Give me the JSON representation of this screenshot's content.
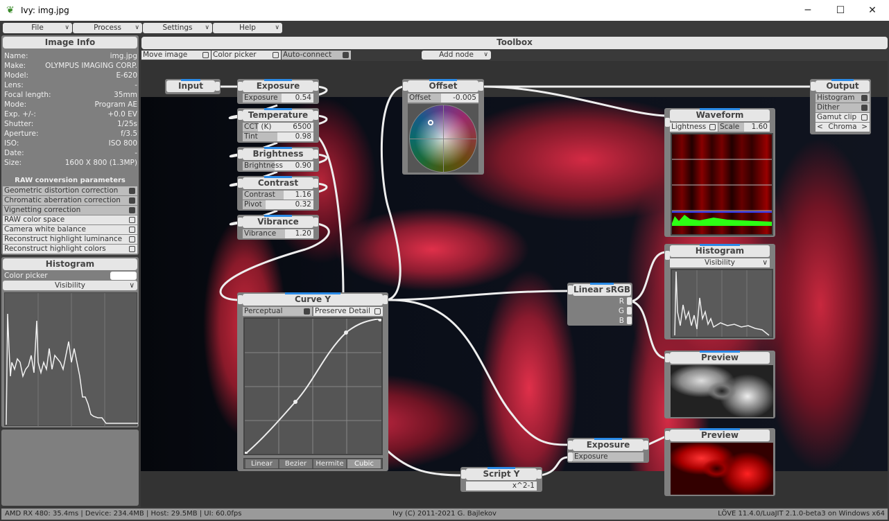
{
  "window": {
    "title": "Ivy: img.jpg",
    "minimize": "─",
    "maximize": "☐",
    "close": "✕"
  },
  "menu": [
    "File",
    "Process",
    "Settings",
    "Help"
  ],
  "image_info": {
    "title": "Image Info",
    "rows": [
      {
        "k": "Name:",
        "v": "img.jpg"
      },
      {
        "k": "Make:",
        "v": "OLYMPUS IMAGING CORP."
      },
      {
        "k": "Model:",
        "v": "E-620"
      },
      {
        "k": "Lens:",
        "v": "-"
      },
      {
        "k": "Focal length:",
        "v": "35mm"
      },
      {
        "k": "Mode:",
        "v": "Program AE"
      },
      {
        "k": "Exp. +/-:",
        "v": "+0.0 EV"
      },
      {
        "k": "Shutter:",
        "v": "1/25s"
      },
      {
        "k": "Aperture:",
        "v": "f/3.5"
      },
      {
        "k": "ISO:",
        "v": "ISO 800"
      },
      {
        "k": "Date:",
        "v": "-"
      },
      {
        "k": "Size:",
        "v": "1600 X 800 (1.3MP)"
      }
    ],
    "raw_title": "RAW conversion parameters",
    "raw": [
      {
        "label": "Geometric distortion correction",
        "on": true
      },
      {
        "label": "Chromatic aberration correction",
        "on": true
      },
      {
        "label": "Vignetting correction",
        "on": true
      },
      {
        "label": "RAW color space",
        "on": false
      },
      {
        "label": "Camera white balance",
        "on": false
      },
      {
        "label": "Reconstruct highlight luminance",
        "on": false
      },
      {
        "label": "Reconstruct highlight colors",
        "on": false
      }
    ]
  },
  "histogram_panel": {
    "title": "Histogram",
    "color_picker": "Color picker",
    "mode": "Visibility"
  },
  "toolbox": {
    "title": "Toolbox",
    "move_image": "Move image",
    "color_picker": "Color picker",
    "auto_connect": "Auto-connect",
    "add_node": "Add node"
  },
  "nodes": {
    "input": "Input",
    "exposure": {
      "title": "Exposure",
      "label": "Exposure",
      "value": "0.54"
    },
    "temperature": {
      "title": "Temperature",
      "cct_label": "CCT (K)",
      "cct": "6500",
      "tint_label": "Tint",
      "tint": "0.98"
    },
    "brightness": {
      "title": "Brightness",
      "label": "Brightness",
      "value": "0.90"
    },
    "contrast": {
      "title": "Contrast",
      "label": "Contrast",
      "value": "1.16",
      "pivot_label": "Pivot",
      "pivot": "0.32"
    },
    "vibrance": {
      "title": "Vibrance",
      "label": "Vibrance",
      "value": "1.20"
    },
    "offset": {
      "title": "Offset",
      "label": "Offset",
      "value": "-0.005"
    },
    "output": {
      "title": "Output",
      "histogram": "Histogram",
      "dither": "Dither",
      "gamut": "Gamut clip",
      "chroma": "Chroma",
      "prev": "<",
      "next": ">"
    },
    "waveform": {
      "title": "Waveform",
      "lightness": "Lightness",
      "scale_label": "Scale",
      "scale": "1.60"
    },
    "histogram": {
      "title": "Histogram",
      "mode": "Visibility"
    },
    "linear": {
      "title": "Linear sRGB",
      "r": "R",
      "g": "G",
      "b": "B"
    },
    "preview1": {
      "title": "Preview"
    },
    "preview2": {
      "title": "Preview"
    },
    "curve": {
      "title": "Curve Y",
      "perceptual": "Perceptual",
      "preserve": "Preserve Detail",
      "modes": [
        "Linear",
        "Bezier",
        "Hermite",
        "Cubic"
      ]
    },
    "exposure2": {
      "title": "Exposure",
      "label": "Exposure"
    },
    "script": {
      "title": "Script Y",
      "expr": "x^2-1"
    }
  },
  "status": {
    "left": "AMD RX 480: 35.4ms | Device: 234.4MB | Host: 29.5MB | UI: 60.0fps",
    "center": "Ivy (C) 2011-2021 G. Bajlekov",
    "right": "LÖVE 11.4.0/LuaJIT 2.1.0-beta3 on Windows x64"
  },
  "colors": {
    "accent": "#2a8ae6",
    "panel": "#7f7f7f",
    "header": "#e6e6e6"
  }
}
